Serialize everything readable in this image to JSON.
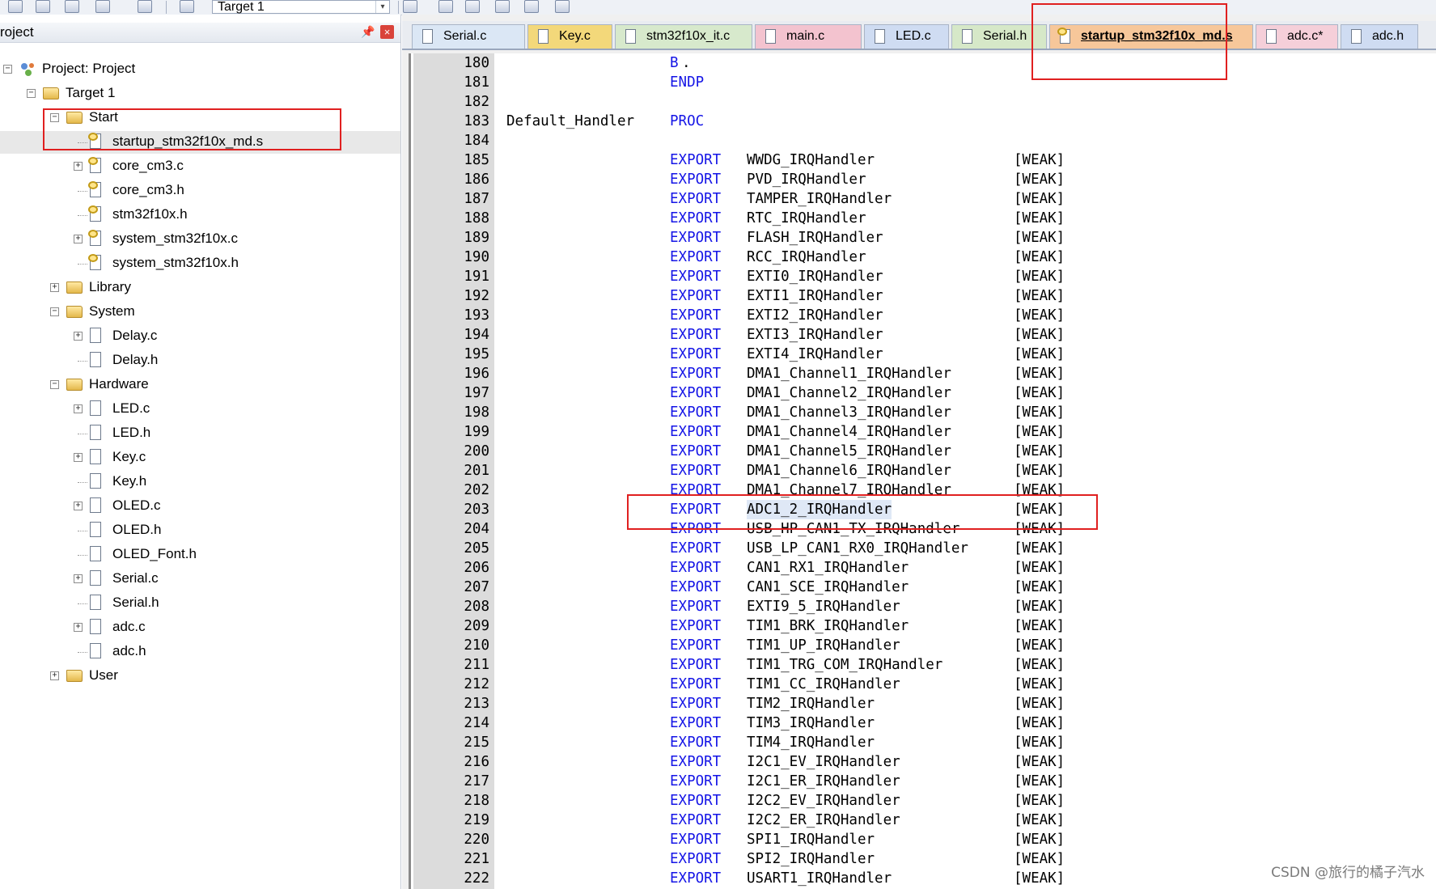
{
  "toolbar": {
    "target_value": "Target 1",
    "icons": [
      "build-icon",
      "rebuild-icon",
      "batch-build-icon",
      "stop-build-icon",
      "download-icon",
      "target-options-icon",
      "manage-components-icon",
      "pack-installer-icon",
      "run-icon",
      "debug-icon"
    ]
  },
  "project_panel": {
    "title": "roject",
    "pin_icon": "pin-icon",
    "close_icon": "close-icon",
    "tree": [
      {
        "label": "Project: Project",
        "level": 0,
        "kind": "project",
        "expander": "minus"
      },
      {
        "label": "Target 1",
        "level": 1,
        "kind": "target",
        "expander": "minus"
      },
      {
        "label": "Start",
        "level": 2,
        "kind": "folder",
        "expander": "minus"
      },
      {
        "label": "startup_stm32f10x_md.s",
        "level": 3,
        "kind": "file-key",
        "expander": "",
        "selected": true
      },
      {
        "label": "core_cm3.c",
        "level": 3,
        "kind": "file-key",
        "expander": "plus"
      },
      {
        "label": "core_cm3.h",
        "level": 3,
        "kind": "file-key",
        "expander": ""
      },
      {
        "label": "stm32f10x.h",
        "level": 3,
        "kind": "file-key",
        "expander": ""
      },
      {
        "label": "system_stm32f10x.c",
        "level": 3,
        "kind": "file-key",
        "expander": "plus"
      },
      {
        "label": "system_stm32f10x.h",
        "level": 3,
        "kind": "file-key",
        "expander": ""
      },
      {
        "label": "Library",
        "level": 2,
        "kind": "folder",
        "expander": "plus"
      },
      {
        "label": "System",
        "level": 2,
        "kind": "folder",
        "expander": "minus"
      },
      {
        "label": "Delay.c",
        "level": 3,
        "kind": "file",
        "expander": "plus"
      },
      {
        "label": "Delay.h",
        "level": 3,
        "kind": "file",
        "expander": ""
      },
      {
        "label": "Hardware",
        "level": 2,
        "kind": "folder",
        "expander": "minus"
      },
      {
        "label": "LED.c",
        "level": 3,
        "kind": "file",
        "expander": "plus"
      },
      {
        "label": "LED.h",
        "level": 3,
        "kind": "file",
        "expander": ""
      },
      {
        "label": "Key.c",
        "level": 3,
        "kind": "file",
        "expander": "plus"
      },
      {
        "label": "Key.h",
        "level": 3,
        "kind": "file",
        "expander": ""
      },
      {
        "label": "OLED.c",
        "level": 3,
        "kind": "file",
        "expander": "plus"
      },
      {
        "label": "OLED.h",
        "level": 3,
        "kind": "file",
        "expander": ""
      },
      {
        "label": "OLED_Font.h",
        "level": 3,
        "kind": "file",
        "expander": ""
      },
      {
        "label": "Serial.c",
        "level": 3,
        "kind": "file",
        "expander": "plus"
      },
      {
        "label": "Serial.h",
        "level": 3,
        "kind": "file",
        "expander": ""
      },
      {
        "label": "adc.c",
        "level": 3,
        "kind": "file",
        "expander": "plus"
      },
      {
        "label": "adc.h",
        "level": 3,
        "kind": "file",
        "expander": ""
      },
      {
        "label": "User",
        "level": 2,
        "kind": "folder",
        "expander": "plus"
      }
    ]
  },
  "editor": {
    "tabs": [
      {
        "label": "Serial.c",
        "color": "#dbe7f5",
        "key": false,
        "active": false
      },
      {
        "label": "Key.c",
        "color": "#f3d87a",
        "key": false,
        "active": false
      },
      {
        "label": "stm32f10x_it.c",
        "color": "#d7e9cc",
        "key": false,
        "active": false
      },
      {
        "label": "main.c",
        "color": "#f3c3cf",
        "key": false,
        "active": false
      },
      {
        "label": "LED.c",
        "color": "#cfdcf2",
        "key": false,
        "active": false
      },
      {
        "label": "Serial.h",
        "color": "#d6e8c8",
        "key": false,
        "active": false
      },
      {
        "label": "startup_stm32f10x_md.s",
        "color": "#f7c79a",
        "key": true,
        "active": true
      },
      {
        "label": "adc.c*",
        "color": "#f5cfd9",
        "key": false,
        "active": false
      },
      {
        "label": "adc.h",
        "color": "#cfdcf2",
        "key": false,
        "active": false
      }
    ],
    "lines": [
      {
        "n": "180",
        "label": "",
        "kw": "B",
        "sym": ".",
        "weak": ""
      },
      {
        "n": "181",
        "label": "",
        "kw": "ENDP",
        "sym": "",
        "weak": ""
      },
      {
        "n": "182",
        "label": "",
        "kw": "",
        "sym": "",
        "weak": ""
      },
      {
        "n": "183",
        "label": "Default_Handler",
        "kw": "PROC",
        "sym": "",
        "weak": ""
      },
      {
        "n": "184",
        "label": "",
        "kw": "",
        "sym": "",
        "weak": ""
      },
      {
        "n": "185",
        "label": "",
        "kw": "EXPORT",
        "sym": "WWDG_IRQHandler",
        "weak": "[WEAK]"
      },
      {
        "n": "186",
        "label": "",
        "kw": "EXPORT",
        "sym": "PVD_IRQHandler",
        "weak": "[WEAK]"
      },
      {
        "n": "187",
        "label": "",
        "kw": "EXPORT",
        "sym": "TAMPER_IRQHandler",
        "weak": "[WEAK]"
      },
      {
        "n": "188",
        "label": "",
        "kw": "EXPORT",
        "sym": "RTC_IRQHandler",
        "weak": "[WEAK]"
      },
      {
        "n": "189",
        "label": "",
        "kw": "EXPORT",
        "sym": "FLASH_IRQHandler",
        "weak": "[WEAK]"
      },
      {
        "n": "190",
        "label": "",
        "kw": "EXPORT",
        "sym": "RCC_IRQHandler",
        "weak": "[WEAK]"
      },
      {
        "n": "191",
        "label": "",
        "kw": "EXPORT",
        "sym": "EXTI0_IRQHandler",
        "weak": "[WEAK]"
      },
      {
        "n": "192",
        "label": "",
        "kw": "EXPORT",
        "sym": "EXTI1_IRQHandler",
        "weak": "[WEAK]"
      },
      {
        "n": "193",
        "label": "",
        "kw": "EXPORT",
        "sym": "EXTI2_IRQHandler",
        "weak": "[WEAK]"
      },
      {
        "n": "194",
        "label": "",
        "kw": "EXPORT",
        "sym": "EXTI3_IRQHandler",
        "weak": "[WEAK]"
      },
      {
        "n": "195",
        "label": "",
        "kw": "EXPORT",
        "sym": "EXTI4_IRQHandler",
        "weak": "[WEAK]"
      },
      {
        "n": "196",
        "label": "",
        "kw": "EXPORT",
        "sym": "DMA1_Channel1_IRQHandler",
        "weak": "[WEAK]"
      },
      {
        "n": "197",
        "label": "",
        "kw": "EXPORT",
        "sym": "DMA1_Channel2_IRQHandler",
        "weak": "[WEAK]"
      },
      {
        "n": "198",
        "label": "",
        "kw": "EXPORT",
        "sym": "DMA1_Channel3_IRQHandler",
        "weak": "[WEAK]"
      },
      {
        "n": "199",
        "label": "",
        "kw": "EXPORT",
        "sym": "DMA1_Channel4_IRQHandler",
        "weak": "[WEAK]"
      },
      {
        "n": "200",
        "label": "",
        "kw": "EXPORT",
        "sym": "DMA1_Channel5_IRQHandler",
        "weak": "[WEAK]"
      },
      {
        "n": "201",
        "label": "",
        "kw": "EXPORT",
        "sym": "DMA1_Channel6_IRQHandler",
        "weak": "[WEAK]"
      },
      {
        "n": "202",
        "label": "",
        "kw": "EXPORT",
        "sym": "DMA1_Channel7_IRQHandler",
        "weak": "[WEAK]"
      },
      {
        "n": "203",
        "label": "",
        "kw": "EXPORT",
        "sym": "ADC1_2_IRQHandler",
        "weak": "[WEAK]",
        "highlight": true
      },
      {
        "n": "204",
        "label": "",
        "kw": "EXPORT",
        "sym": "USB_HP_CAN1_TX_IRQHandler",
        "weak": "[WEAK]"
      },
      {
        "n": "205",
        "label": "",
        "kw": "EXPORT",
        "sym": "USB_LP_CAN1_RX0_IRQHandler",
        "weak": "[WEAK]"
      },
      {
        "n": "206",
        "label": "",
        "kw": "EXPORT",
        "sym": "CAN1_RX1_IRQHandler",
        "weak": "[WEAK]"
      },
      {
        "n": "207",
        "label": "",
        "kw": "EXPORT",
        "sym": "CAN1_SCE_IRQHandler",
        "weak": "[WEAK]"
      },
      {
        "n": "208",
        "label": "",
        "kw": "EXPORT",
        "sym": "EXTI9_5_IRQHandler",
        "weak": "[WEAK]"
      },
      {
        "n": "209",
        "label": "",
        "kw": "EXPORT",
        "sym": "TIM1_BRK_IRQHandler",
        "weak": "[WEAK]"
      },
      {
        "n": "210",
        "label": "",
        "kw": "EXPORT",
        "sym": "TIM1_UP_IRQHandler",
        "weak": "[WEAK]"
      },
      {
        "n": "211",
        "label": "",
        "kw": "EXPORT",
        "sym": "TIM1_TRG_COM_IRQHandler",
        "weak": "[WEAK]"
      },
      {
        "n": "212",
        "label": "",
        "kw": "EXPORT",
        "sym": "TIM1_CC_IRQHandler",
        "weak": "[WEAK]"
      },
      {
        "n": "213",
        "label": "",
        "kw": "EXPORT",
        "sym": "TIM2_IRQHandler",
        "weak": "[WEAK]"
      },
      {
        "n": "214",
        "label": "",
        "kw": "EXPORT",
        "sym": "TIM3_IRQHandler",
        "weak": "[WEAK]"
      },
      {
        "n": "215",
        "label": "",
        "kw": "EXPORT",
        "sym": "TIM4_IRQHandler",
        "weak": "[WEAK]"
      },
      {
        "n": "216",
        "label": "",
        "kw": "EXPORT",
        "sym": "I2C1_EV_IRQHandler",
        "weak": "[WEAK]"
      },
      {
        "n": "217",
        "label": "",
        "kw": "EXPORT",
        "sym": "I2C1_ER_IRQHandler",
        "weak": "[WEAK]"
      },
      {
        "n": "218",
        "label": "",
        "kw": "EXPORT",
        "sym": "I2C2_EV_IRQHandler",
        "weak": "[WEAK]"
      },
      {
        "n": "219",
        "label": "",
        "kw": "EXPORT",
        "sym": "I2C2_ER_IRQHandler",
        "weak": "[WEAK]"
      },
      {
        "n": "220",
        "label": "",
        "kw": "EXPORT",
        "sym": "SPI1_IRQHandler",
        "weak": "[WEAK]"
      },
      {
        "n": "221",
        "label": "",
        "kw": "EXPORT",
        "sym": "SPI2_IRQHandler",
        "weak": "[WEAK]"
      },
      {
        "n": "222",
        "label": "",
        "kw": "EXPORT",
        "sym": "USART1_IRQHandler",
        "weak": "[WEAK]"
      }
    ]
  },
  "watermark": "CSDN @旅行的橘子汽水",
  "colors": {
    "keyword": "#1515e6",
    "annotation_red": "#e02020",
    "gutter": "#dcdcdc"
  }
}
